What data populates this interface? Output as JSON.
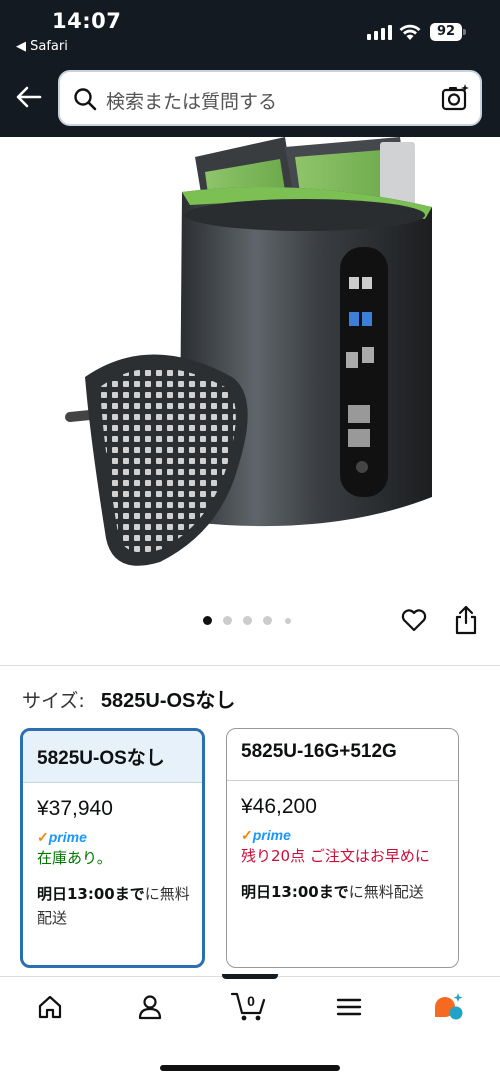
{
  "status": {
    "time": "14:07",
    "back_app": "◀ Safari",
    "battery": "92"
  },
  "search": {
    "placeholder": "検索または質問する"
  },
  "carousel": {
    "count": 5,
    "active_index": 0
  },
  "size": {
    "label": "サイズ:",
    "value": "5825U-OSなし"
  },
  "options": [
    {
      "name": "5825U-OSなし",
      "price": "¥37,940",
      "prime": "prime",
      "stock": "在庫あり。",
      "delivery_bold": "明日13:00まで",
      "delivery_rest": "に無料配送",
      "selected": true
    },
    {
      "name": "5825U-16G+512G",
      "price": "¥46,200",
      "prime": "prime",
      "stock": "残り20点 ご注文はお早めに",
      "delivery_bold": "明日13:00まで",
      "delivery_rest": "に無料配送",
      "selected": false
    }
  ],
  "bottom_nav": {
    "items": [
      "home-icon",
      "account-icon",
      "cart-icon",
      "menu-icon",
      "rufus-icon"
    ],
    "cart_count": "0"
  },
  "colors": {
    "header_bg": "#131a22",
    "selected_border": "#2a6fb0",
    "prime_blue": "#1a98ff",
    "in_stock_green": "#007600",
    "low_stock_red": "#cc0c39"
  }
}
